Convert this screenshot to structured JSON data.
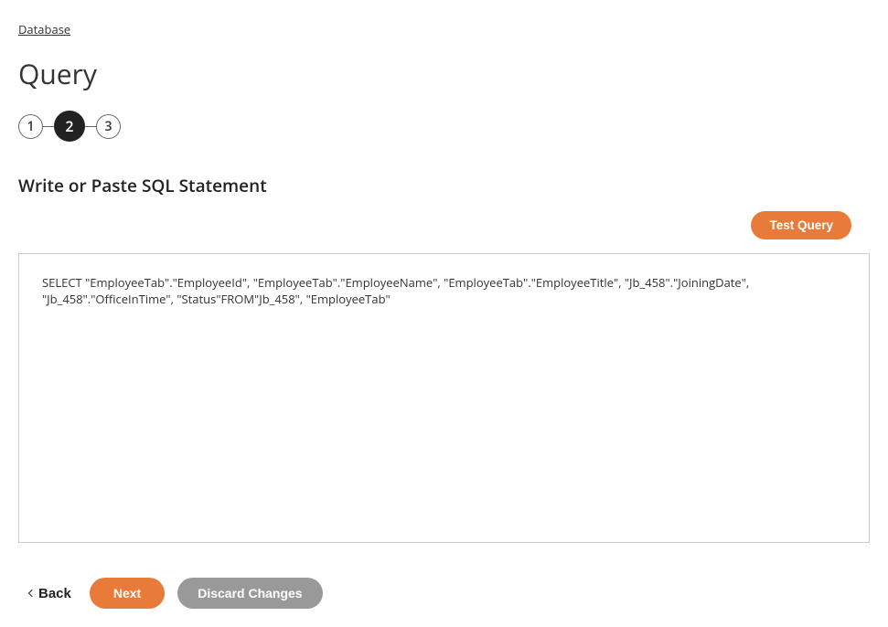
{
  "breadcrumb": {
    "label": "Database"
  },
  "page": {
    "title": "Query",
    "section_heading": "Write or Paste SQL Statement"
  },
  "stepper": {
    "steps": [
      "1",
      "2",
      "3"
    ],
    "active_index": 1
  },
  "actions": {
    "test_query": "Test Query",
    "back": "Back",
    "next": "Next",
    "discard": "Discard Changes"
  },
  "sql": {
    "value": "SELECT \"EmployeeTab\".\"EmployeeId\", \"EmployeeTab\".\"EmployeeName\", \"EmployeeTab\".\"EmployeeTitle\", \"Jb_458\".\"JoiningDate\", \"Jb_458\".\"OfficeInTime\", \"Status\"FROM\"Jb_458\", \"EmployeeTab\""
  }
}
